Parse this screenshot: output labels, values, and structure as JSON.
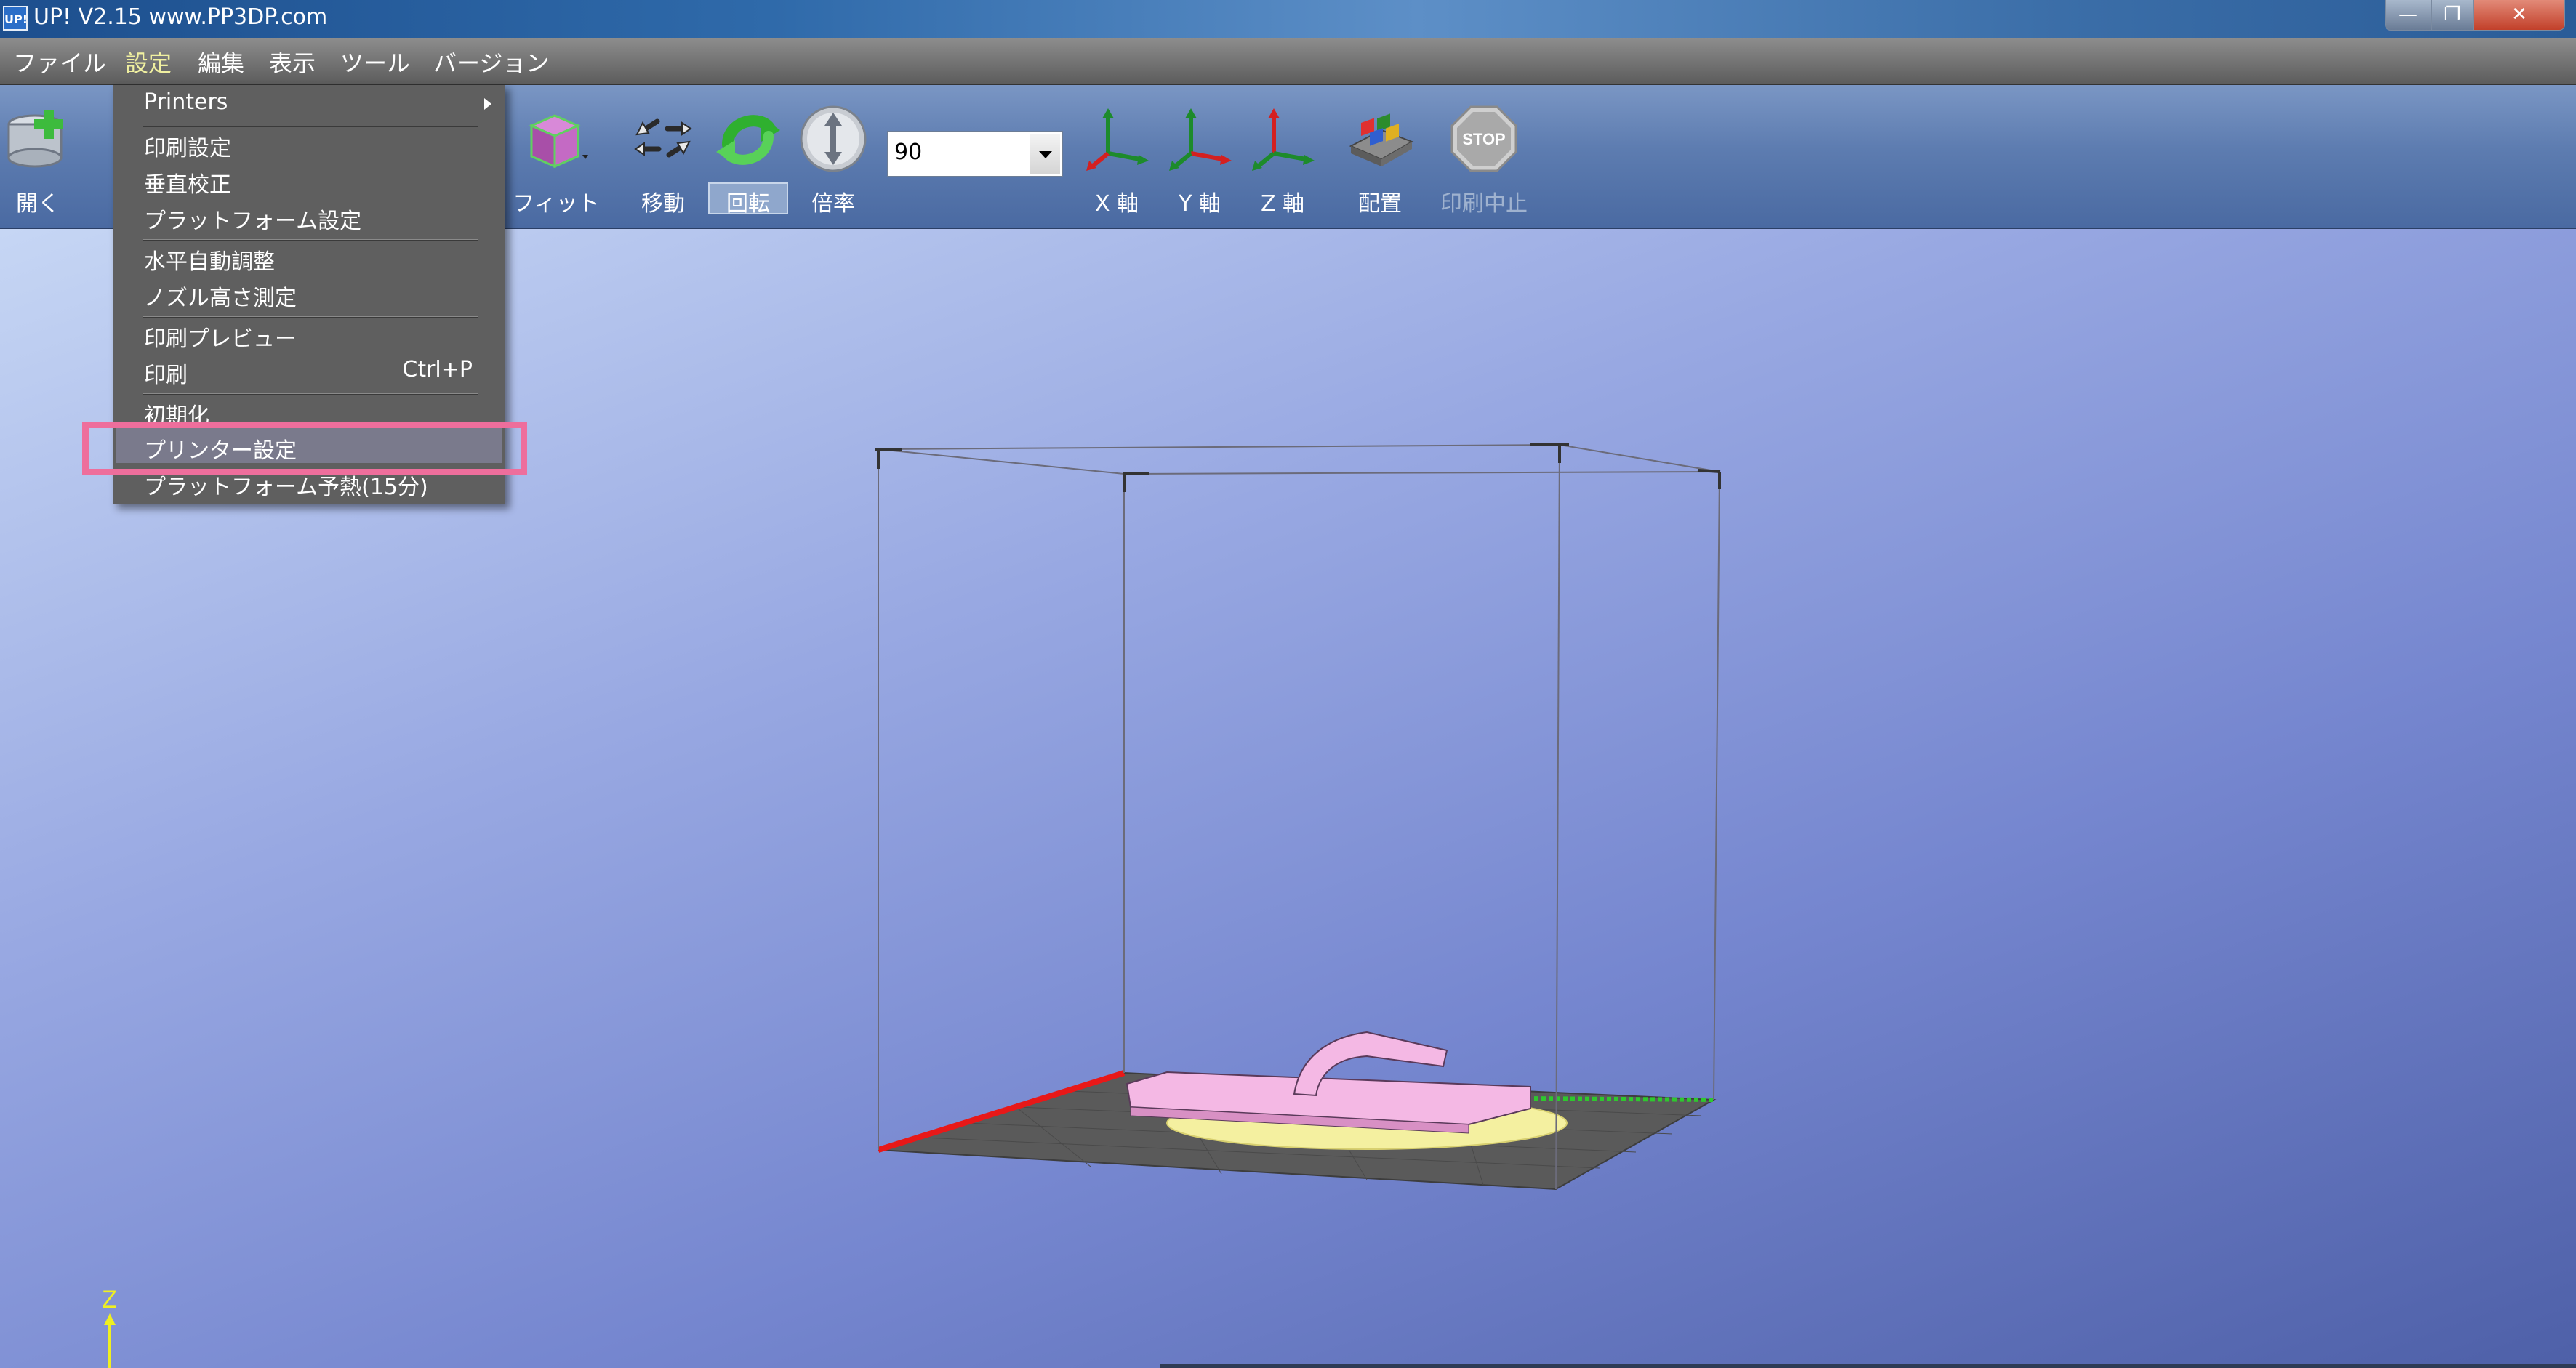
{
  "window": {
    "icon_text": "UP!",
    "title": "UP!  V2.15 www.PP3DP.com",
    "buttons": {
      "minimize": "—",
      "maximize": "❐",
      "close": "✕"
    }
  },
  "menubar": {
    "items": [
      "ファイル",
      "設定",
      "編集",
      "表示",
      "ツール",
      "バージョン"
    ],
    "active": "設定"
  },
  "toolbar": {
    "open": "開く",
    "fit": "フィット",
    "move": "移動",
    "rotate": "回転",
    "scale": "倍率",
    "scale_value": "90",
    "x_axis": "X 軸",
    "y_axis": "Y 軸",
    "z_axis": "Z 軸",
    "place": "配置",
    "stop_icon_text": "STOP",
    "stop": "印刷中止"
  },
  "settings_menu": {
    "printers": "Printers",
    "print_settings": "印刷設定",
    "vertical_calibration": "垂直校正",
    "platform_settings": "プラットフォーム設定",
    "auto_level": "水平自動調整",
    "nozzle_height": "ノズル高さ測定",
    "print_preview": "印刷プレビュー",
    "print": "印刷",
    "print_shortcut": "Ctrl+P",
    "initialize": "初期化",
    "printer_settings": "プリンター設定",
    "platform_preheat": "プラットフォーム予熱(15分)"
  },
  "viewport": {
    "axis_label": "Z"
  },
  "colors": {
    "highlight": "#ee6e9c",
    "model": "#f4b8e4",
    "build_plate": "#5a5a5a",
    "support": "#f4f0a0"
  }
}
